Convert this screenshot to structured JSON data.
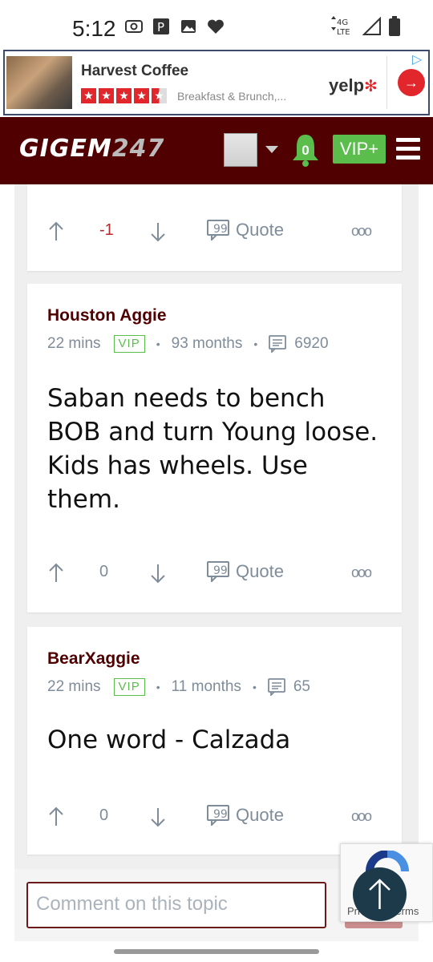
{
  "status_bar": {
    "time": "5:12",
    "network": "4G LTE"
  },
  "ad": {
    "title": "Harvest Coffee",
    "subtitle": "Breakfast & Brunch,...",
    "brand": "yelp",
    "rating_stars": 4.5
  },
  "header": {
    "logo_text": "GIGEM",
    "logo_num": "247",
    "notification_count": "0",
    "vip_label": "VIP+"
  },
  "posts": [
    {
      "score": "-1",
      "quote_label": "Quote"
    },
    {
      "author": "Houston Aggie",
      "time": "22 mins",
      "badge": "VIP",
      "tenure": "93 months",
      "post_count": "6920",
      "body": "Saban needs to bench BOB and turn Young loose. Kids has wheels. Use them.",
      "score": "0",
      "quote_label": "Quote"
    },
    {
      "author": "BearXaggie",
      "time": "22 mins",
      "badge": "VIP",
      "tenure": "11 months",
      "post_count": "65",
      "body": "One word - Calzada",
      "score": "0",
      "quote_label": "Quote"
    }
  ],
  "composer": {
    "placeholder": "Comment on this topic"
  },
  "recaptcha": {
    "text": "Privacy - Terms"
  },
  "colors": {
    "brand": "#500000",
    "vip": "#5bbd4c",
    "muted": "#7f8c99"
  }
}
